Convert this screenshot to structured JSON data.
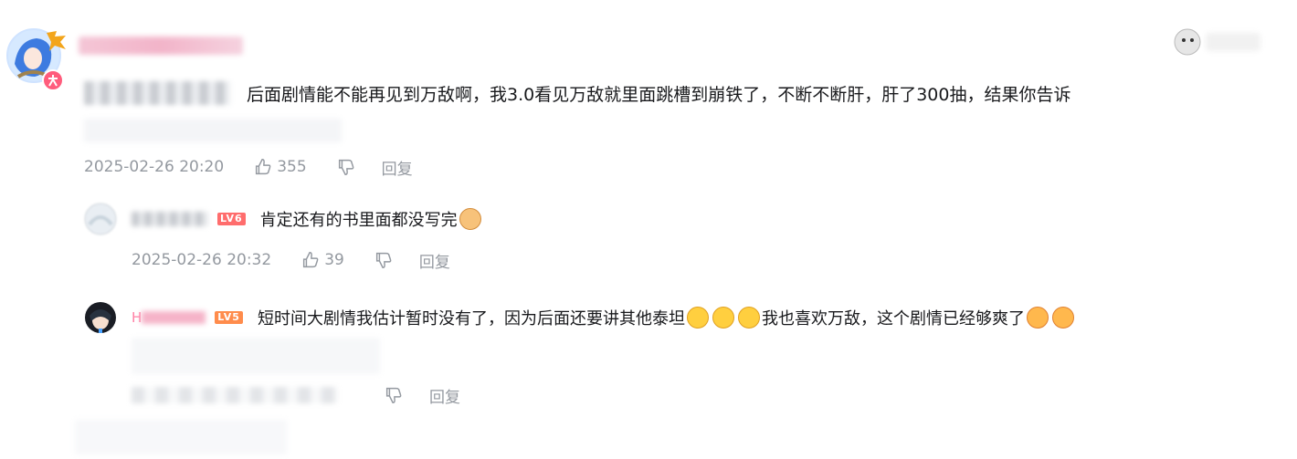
{
  "comment": {
    "text": "后面剧情能不能再见到万敌啊，我3.0看见万敌就里面跳槽到崩铁了，不断不断肝，肝了300抽，结果你告诉",
    "time": "2025-02-26 20:20",
    "likes": "355",
    "reply_label": "回复"
  },
  "replies": [
    {
      "level": "LV6",
      "text": "肯定还有的书里面都没写完",
      "time": "2025-02-26 20:32",
      "likes": "39",
      "reply_label": "回复"
    },
    {
      "username_visible": "H",
      "level": "LV5",
      "text_a": "短时间大剧情我估计暂时没有了，因为后面还要讲其他泰坦",
      "text_b": "我也喜欢万敌，这个剧情已经够爽了",
      "reply_label": "回复"
    }
  ],
  "colors": {
    "meta": "#9499a0",
    "level_badge": "#ff6d6d",
    "avatar_badge": "#ff5c7c"
  },
  "icons": {
    "like": "thumbs-up-icon",
    "dislike": "thumbs-down-icon",
    "emoji_cat": "cat-face-emoji",
    "emoji_laugh": "laughing-tears-emoji",
    "emoji_shock": "shocked-face-emoji"
  }
}
